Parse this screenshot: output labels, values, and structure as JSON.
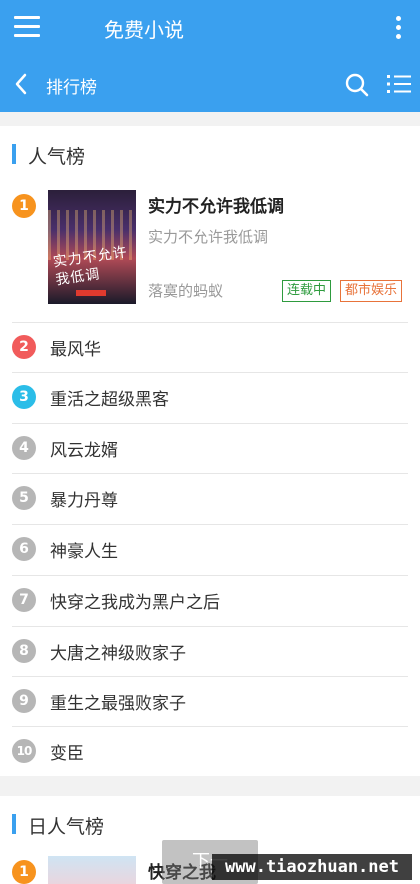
{
  "appbar": {
    "title": "免费小说",
    "menu_icon": "menu-icon",
    "more_icon": "more-vertical-icon"
  },
  "subbar": {
    "title": "排行榜",
    "back_icon": "chevron-left-icon",
    "search_icon": "search-icon",
    "list_icon": "list-icon"
  },
  "section1": {
    "title": "人气榜",
    "featured": {
      "rank": "1",
      "title": "实力不允许我低调",
      "subtitle": "实力不允许我低调",
      "author": "落寞的蚂蚁",
      "cover_text": "实力不允许我低调",
      "tags": [
        "连载中",
        "都市娱乐"
      ]
    },
    "items": [
      {
        "rank": "2",
        "name": "最风华"
      },
      {
        "rank": "3",
        "name": "重活之超级黑客"
      },
      {
        "rank": "4",
        "name": "风云龙婿"
      },
      {
        "rank": "5",
        "name": "暴力丹尊"
      },
      {
        "rank": "6",
        "name": "神豪人生"
      },
      {
        "rank": "7",
        "name": "快穿之我成为黑户之后"
      },
      {
        "rank": "8",
        "name": "大唐之神级败家子"
      },
      {
        "rank": "9",
        "name": "重生之最强败家子"
      },
      {
        "rank": "10",
        "name": "变臣"
      }
    ]
  },
  "section2": {
    "title": "日人气榜",
    "featured": {
      "rank": "1",
      "title": "快穿之我"
    }
  },
  "overlay": {
    "toast": "下一",
    "watermark": "www.tiaozhuan.net"
  },
  "colors": {
    "primary": "#3aa0ef",
    "rank1": "#f7931e",
    "rank2": "#f15b5b",
    "rank3": "#2bbde8",
    "rank_other": "#b6b6b6",
    "tag_serial": "#2e9b3e",
    "tag_genre": "#e8733a"
  }
}
